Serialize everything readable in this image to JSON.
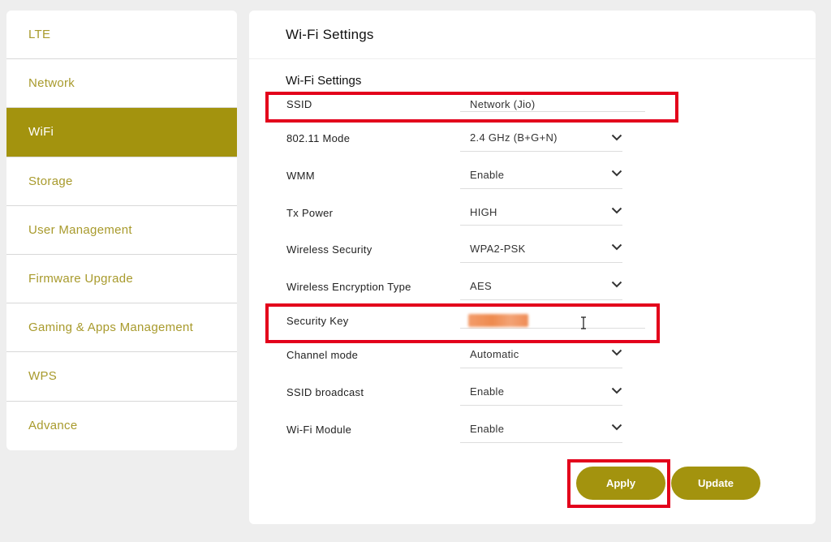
{
  "sidebar": {
    "items": [
      {
        "label": "LTE"
      },
      {
        "label": "Network"
      },
      {
        "label": "WiFi",
        "active": true
      },
      {
        "label": "Storage"
      },
      {
        "label": "User Management"
      },
      {
        "label": "Firmware Upgrade"
      },
      {
        "label": "Gaming & Apps Management"
      },
      {
        "label": "WPS"
      },
      {
        "label": "Advance"
      }
    ]
  },
  "main": {
    "title": "Wi-Fi Settings",
    "section_title": "Wi-Fi Settings",
    "fields": {
      "ssid": {
        "label": "SSID",
        "value": "Network (Jio)"
      },
      "mode": {
        "label": "802.11 Mode",
        "value": "2.4 GHz (B+G+N)"
      },
      "wmm": {
        "label": "WMM",
        "value": "Enable"
      },
      "tx_power": {
        "label": "Tx Power",
        "value": "HIGH"
      },
      "wireless_security": {
        "label": "Wireless Security",
        "value": "WPA2-PSK"
      },
      "encryption_type": {
        "label": "Wireless Encryption Type",
        "value": "AES"
      },
      "security_key": {
        "label": "Security Key",
        "value": ""
      },
      "channel_mode": {
        "label": "Channel mode",
        "value": "Automatic"
      },
      "ssid_broadcast": {
        "label": "SSID broadcast",
        "value": "Enable"
      },
      "wifi_module": {
        "label": "Wi-Fi Module",
        "value": "Enable"
      }
    },
    "buttons": {
      "apply": "Apply",
      "update": "Update"
    }
  },
  "colors": {
    "accent": "#a3930e",
    "sidebar_text": "#a89a2c",
    "highlight": "#e3001b",
    "background": "#eeeeee"
  },
  "icons": {
    "dropdown": "chevron-down-icon",
    "text_cursor": "ibeam-cursor-icon"
  }
}
